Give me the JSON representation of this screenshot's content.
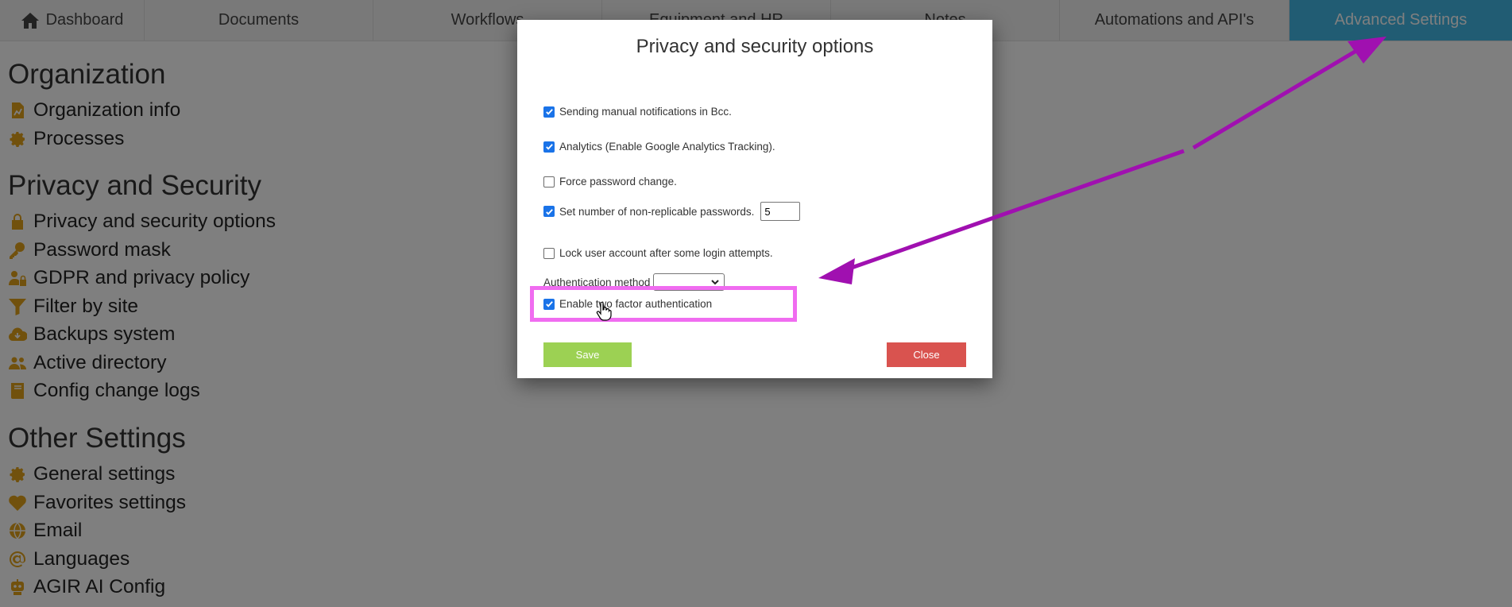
{
  "nav": {
    "tabs": [
      {
        "label": "Dashboard"
      },
      {
        "label": "Documents"
      },
      {
        "label": "Workflows"
      },
      {
        "label": "Equipment and HR"
      },
      {
        "label": "Notes"
      },
      {
        "label": "Automations and API's"
      },
      {
        "label": "Advanced Settings"
      }
    ],
    "active_color": "#42b8e6"
  },
  "sidebar": {
    "sections": [
      {
        "title": "Organization",
        "items": [
          {
            "label": "Organization info",
            "icon": "chart-file-icon"
          },
          {
            "label": "Processes",
            "icon": "gear-icon"
          }
        ]
      },
      {
        "title": "Privacy and Security",
        "items": [
          {
            "label": "Privacy and security options",
            "icon": "lock-icon"
          },
          {
            "label": "Password mask",
            "icon": "key-icon"
          },
          {
            "label": "GDPR and privacy policy",
            "icon": "user-lock-icon"
          },
          {
            "label": "Filter by site",
            "icon": "filter-icon"
          },
          {
            "label": "Backups system",
            "icon": "cloud-download-icon"
          },
          {
            "label": "Active directory",
            "icon": "users-icon"
          },
          {
            "label": "Config change logs",
            "icon": "book-icon"
          }
        ]
      },
      {
        "title": "Other Settings",
        "items": [
          {
            "label": "General settings",
            "icon": "gear-icon"
          },
          {
            "label": "Favorites settings",
            "icon": "heart-icon"
          },
          {
            "label": "Email",
            "icon": "globe-icon"
          },
          {
            "label": "Languages",
            "icon": "at-icon"
          },
          {
            "label": "AGIR AI Config",
            "icon": "robot-icon"
          }
        ]
      }
    ],
    "icon_color": "#e3a21a"
  },
  "modal": {
    "title": "Privacy and security options",
    "options": {
      "bcc": {
        "label": "Sending manual notifications in Bcc.",
        "checked": true
      },
      "analytics": {
        "label": "Analytics (Enable Google Analytics Tracking).",
        "checked": true
      },
      "force_password": {
        "label": "Force password change.",
        "checked": false
      },
      "non_replicable": {
        "label": "Set number of non-replicable passwords.",
        "checked": true,
        "value": "5"
      },
      "lock_account": {
        "label": "Lock user account after some login attempts.",
        "checked": false
      },
      "auth_method": {
        "label": "Authentication method",
        "value": ""
      },
      "two_factor": {
        "label": "Enable two factor authentication",
        "checked": true
      }
    },
    "save_label": "Save",
    "close_label": "Close",
    "save_color": "#9cd153",
    "close_color": "#d9534f",
    "highlight_color": "#f06cf0",
    "arrow_color": "#a010b0"
  }
}
